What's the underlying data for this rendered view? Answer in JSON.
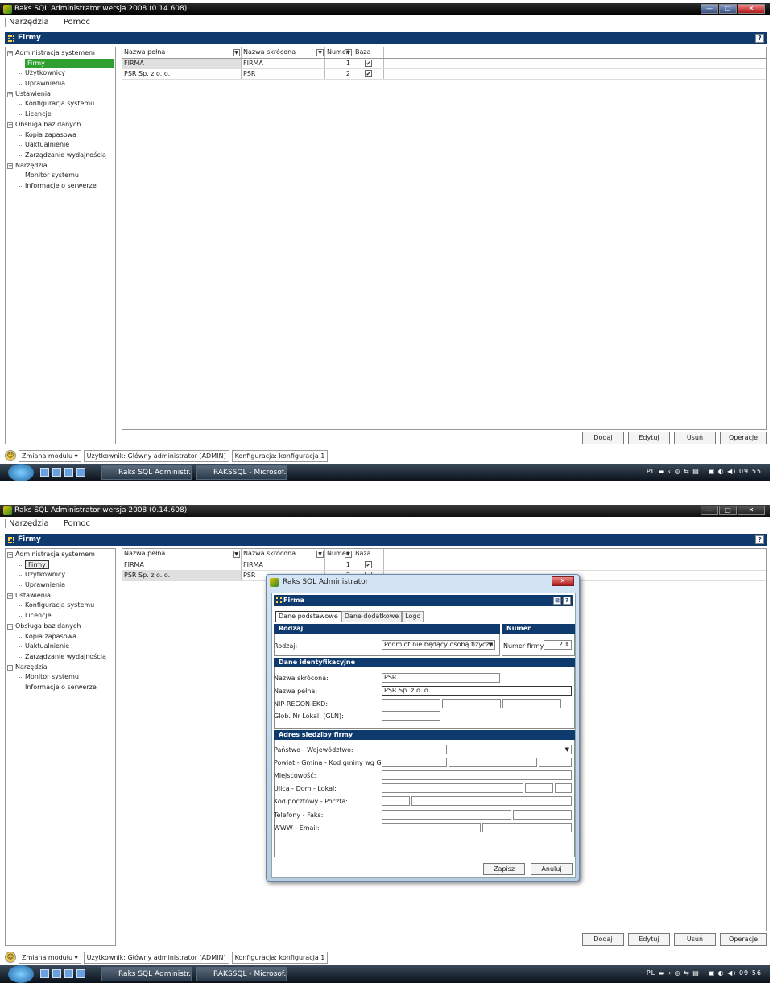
{
  "app": {
    "title": "Raks SQL Administrator wersja 2008 (0.14.608)"
  },
  "menu": {
    "items": [
      "Narzędzia",
      "Pomoc"
    ]
  },
  "panel": {
    "title": "Firmy",
    "help": "?"
  },
  "tree": {
    "items": [
      {
        "label": "Administracja systemem",
        "level": 0,
        "expander": "−"
      },
      {
        "label": "Firmy",
        "level": 1
      },
      {
        "label": "Użytkownicy",
        "level": 1
      },
      {
        "label": "Uprawnienia",
        "level": 1
      },
      {
        "label": "Ustawienia",
        "level": 0,
        "expander": "−"
      },
      {
        "label": "Konfiguracja systemu",
        "level": 1
      },
      {
        "label": "Licencje",
        "level": 1
      },
      {
        "label": "Obsługa baz danych",
        "level": 0,
        "expander": "−"
      },
      {
        "label": "Kopia zapasowa",
        "level": 1
      },
      {
        "label": "Uaktualnienie",
        "level": 1
      },
      {
        "label": "Zarządzanie wydajnością",
        "level": 1
      },
      {
        "label": "Narzędzia",
        "level": 0,
        "expander": "−"
      },
      {
        "label": "Monitor systemu",
        "level": 1
      },
      {
        "label": "Informacje o serwerze",
        "level": 1
      }
    ]
  },
  "grid": {
    "columns": [
      "Nazwa pełna",
      "Nazwa skrócona",
      "Numer",
      "Baza"
    ],
    "rows": [
      {
        "full": "FIRMA",
        "short": "FIRMA",
        "number": "1",
        "db": "✔"
      },
      {
        "full": "PSR Sp. z o. o.",
        "short": "PSR",
        "number": "2",
        "db": "✔"
      }
    ]
  },
  "actions": {
    "add": "Dodaj",
    "edit": "Edytuj",
    "delete": "Usuń",
    "ops": "Operacje"
  },
  "status": {
    "module": "Zmiana modułu",
    "user": "Użytkownik: Główny administrator [ADMIN]",
    "config": "Konfiguracja: konfiguracja 1"
  },
  "taskbar": {
    "item1": "Raks SQL Administr...",
    "item2": "RAKSSQL - Microsof...",
    "lang": "PL",
    "time1": "09:55",
    "time2": "09:56"
  },
  "dialog": {
    "title": "Raks SQL Administrator",
    "header": "Firma",
    "tabs": [
      "Dane podstawowe",
      "Dane dodatkowe",
      "Logo"
    ],
    "section_type": "Rodzaj",
    "section_number": "Numer",
    "type_label": "Rodzaj:",
    "type_value": "Podmiot nie będący osobą fizyczną",
    "number_label": "Numer firmy:",
    "number_value": "2",
    "section_ident": "Dane identyfikacyjne",
    "short_label": "Nazwa skrócona:",
    "short_value": "PSR",
    "full_label": "Nazwa pełna:",
    "full_value": "PSR Sp. z o. o.",
    "nip_label": "NIP-REGON-EKD:",
    "gln_label": "Glob. Nr Lokal. (GLN):",
    "section_address": "Adres siedziby firmy",
    "addr_labels": [
      "Państwo - Województwo:",
      "Powiat - Gmina - Kod gminy wg GUS:",
      "Miejscowość:",
      "Ulica - Dom - Lokal:",
      "Kod pocztowy - Poczta:",
      "Telefony - Faks:",
      "WWW - Email:"
    ],
    "save": "Zapisz",
    "cancel": "Anuluj"
  }
}
